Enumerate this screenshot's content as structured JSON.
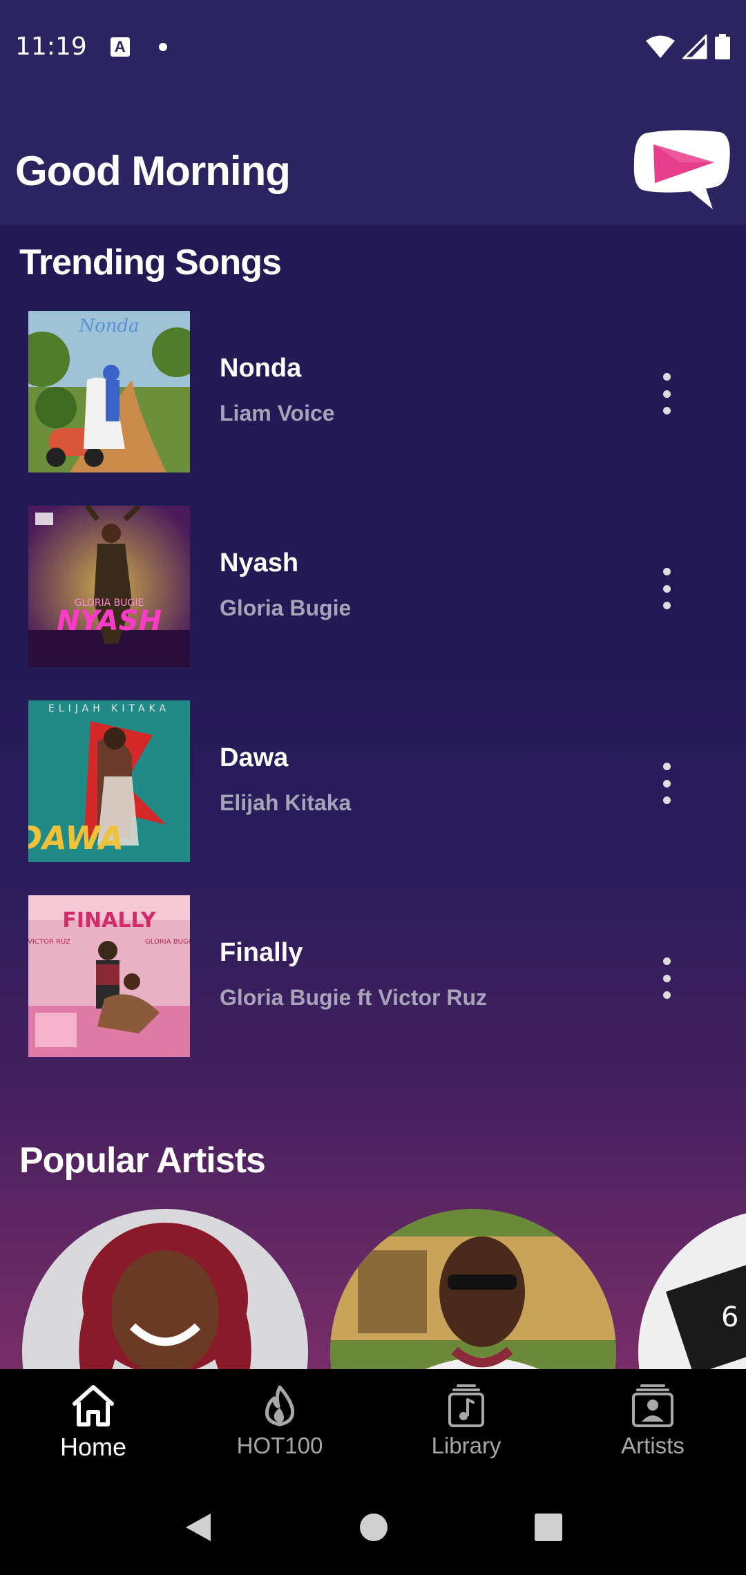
{
  "status_bar": {
    "time": "11:19",
    "notification_icon": "A"
  },
  "header": {
    "greeting": "Good Morning",
    "logo_icon": "play-bubble-logo"
  },
  "trending": {
    "title": "Trending Songs",
    "songs": [
      {
        "title": "Nonda",
        "artist": "Liam Voice"
      },
      {
        "title": "Nyash",
        "artist": "Gloria Bugie"
      },
      {
        "title": "Dawa",
        "artist": "Elijah Kitaka"
      },
      {
        "title": "Finally",
        "artist": "Gloria Bugie ft Victor Ruz"
      }
    ]
  },
  "popular": {
    "title": "Popular Artists"
  },
  "bottom_nav": {
    "items": [
      {
        "label": "Home",
        "icon": "home-icon",
        "active": true
      },
      {
        "label": "HOT100",
        "icon": "flame-icon",
        "active": false
      },
      {
        "label": "Library",
        "icon": "music-library-icon",
        "active": false
      },
      {
        "label": "Artists",
        "icon": "artists-icon",
        "active": false
      }
    ]
  },
  "colors": {
    "header_bg": "#2c2461",
    "page_bg": "#231a55",
    "accent_pink": "#e63e8a",
    "secondary_text": "#a7a3b8"
  }
}
